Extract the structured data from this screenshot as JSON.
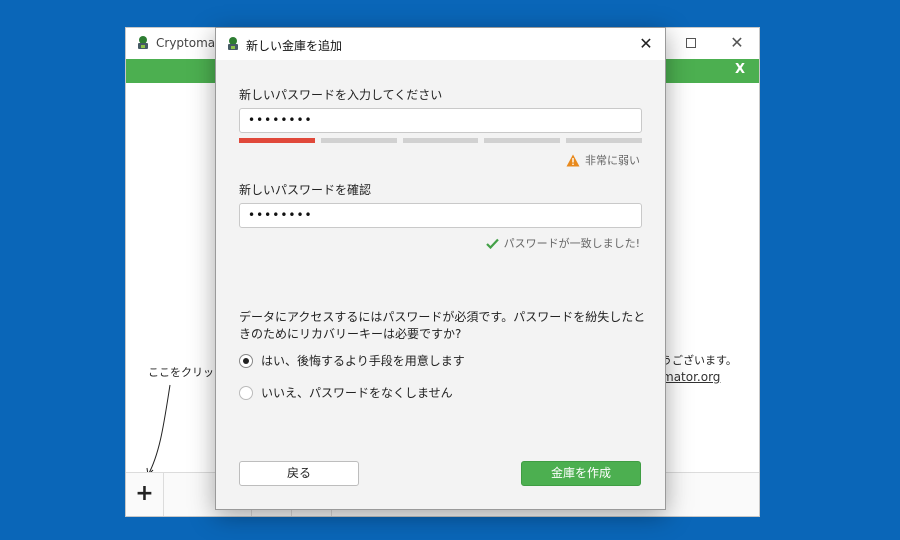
{
  "main_window": {
    "title": "Cryptomato",
    "banner_close": "X",
    "hint_left": "ここをクリックし",
    "hint_right": "うございます。",
    "hint_link": "mator.org",
    "add_button": "+"
  },
  "dialog": {
    "title": "新しい金庫を追加",
    "password_label": "新しいパスワードを入力してください",
    "password_value": "••••••••",
    "strength_level": 1,
    "strength_segments": 5,
    "strength_text": "非常に弱い",
    "confirm_label": "新しいパスワードを確認",
    "confirm_value": "••••••••",
    "match_text": "パスワードが一致しました!",
    "recovery_question": "データにアクセスするにはパスワードが必須です。パスワードを紛失したときのためにリカバリーキーは必要ですか?",
    "option_yes": "はい、後悔するより手段を用意します",
    "option_no": "いいえ、パスワードをなくしません",
    "selected_option": "yes",
    "back_button": "戻る",
    "create_button": "金庫を作成"
  },
  "colors": {
    "desktop": "#0a66b8",
    "accent_green": "#4caf50",
    "strength_weak": "#e0483a",
    "warning_orange": "#e8891c",
    "check_green": "#43a047"
  },
  "icons": {
    "app": "cryptomator-robot-icon",
    "warning": "warning-triangle-icon",
    "match": "checkmark-icon"
  }
}
